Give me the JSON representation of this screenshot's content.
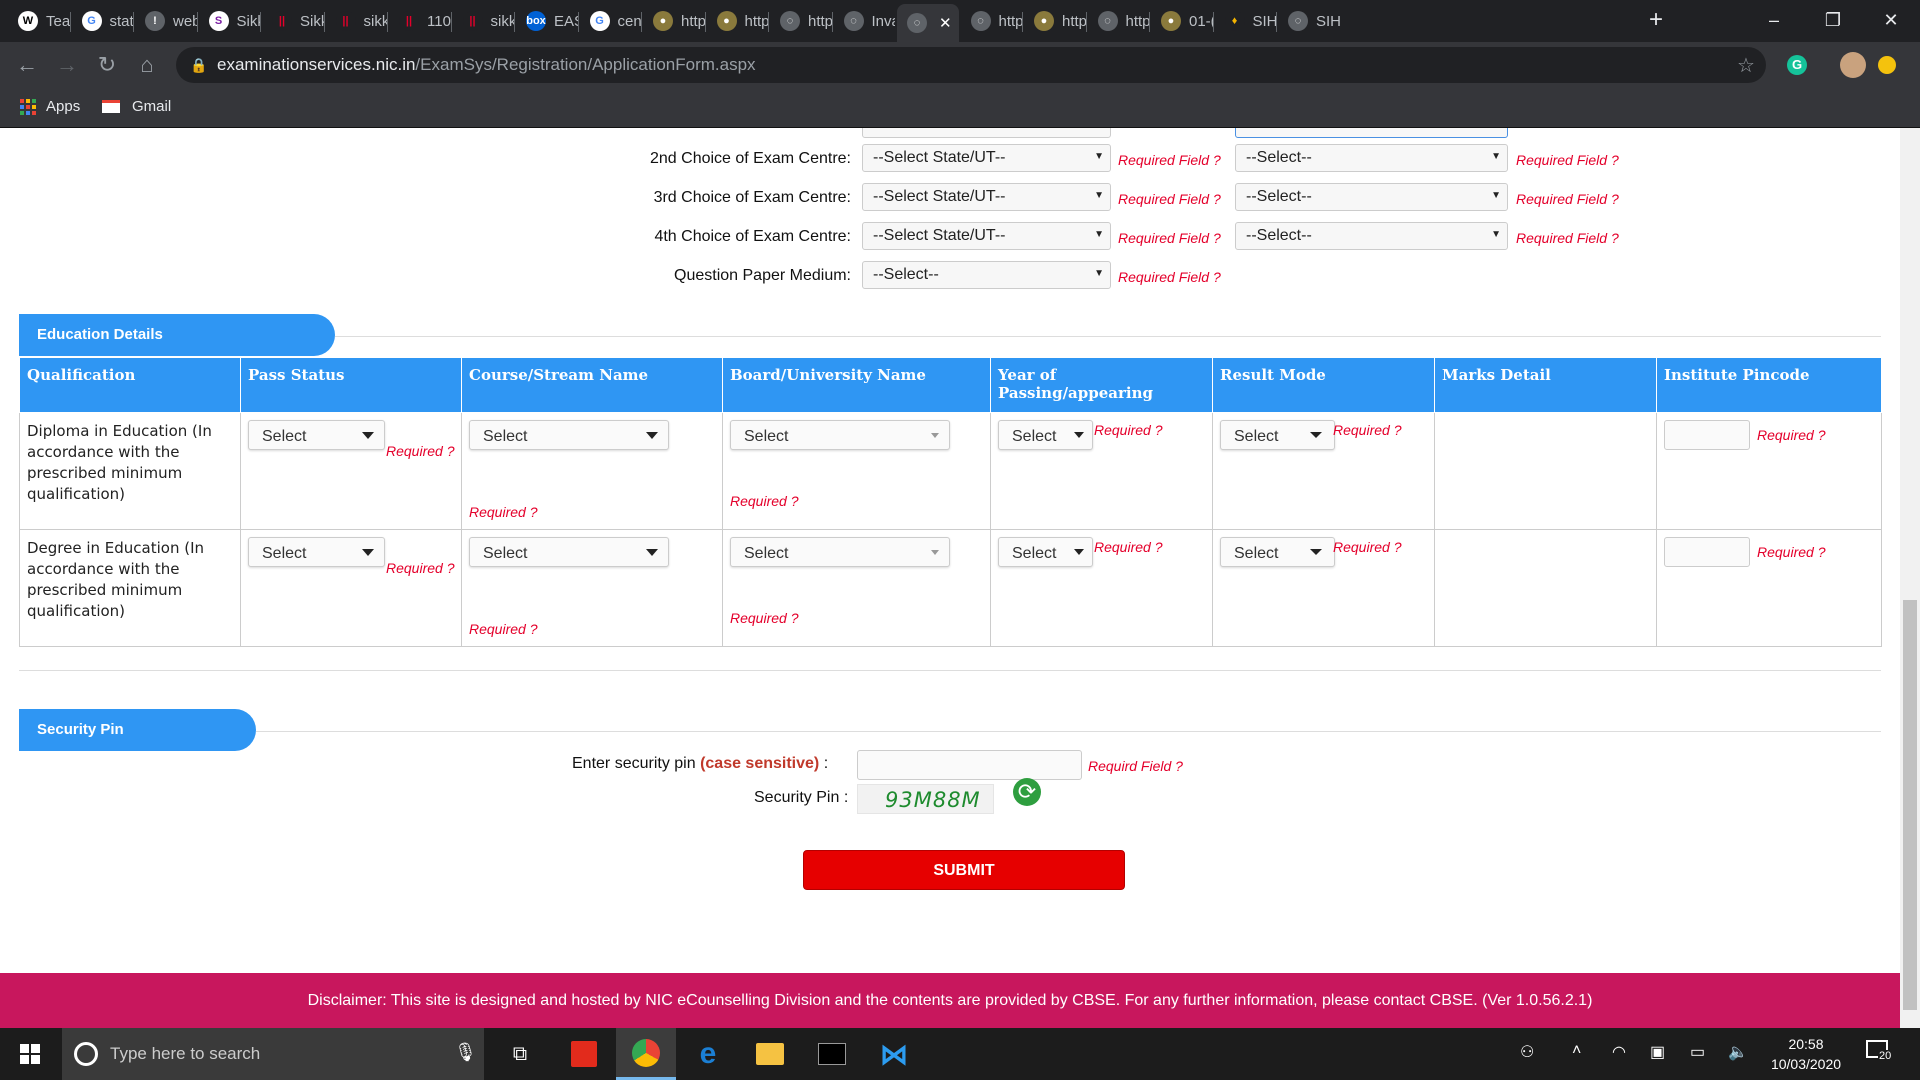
{
  "browser": {
    "tabs": [
      {
        "label": "Teac",
        "fav": "W",
        "color": "#fff",
        "fg": "#000"
      },
      {
        "label": "state",
        "fav": "G",
        "color": "#fff",
        "fg": "#4285f4"
      },
      {
        "label": "web",
        "fav": "!",
        "color": "#5f6368",
        "fg": "#fff"
      },
      {
        "label": "Sikk",
        "fav": "S",
        "color": "#fff",
        "fg": "#7a1fa2"
      },
      {
        "label": "Sikk",
        "fav": "||",
        "color": "#202124",
        "fg": "#e4002b"
      },
      {
        "label": "sikk",
        "fav": "||",
        "color": "#202124",
        "fg": "#e4002b"
      },
      {
        "label": "110",
        "fav": "||",
        "color": "#202124",
        "fg": "#e4002b"
      },
      {
        "label": "sikk",
        "fav": "||",
        "color": "#202124",
        "fg": "#e4002b"
      },
      {
        "label": "EAS",
        "fav": "box",
        "color": "#0061d5",
        "fg": "#fff"
      },
      {
        "label": "cent",
        "fav": "G",
        "color": "#fff",
        "fg": "#4285f4"
      },
      {
        "label": "http",
        "fav": "●",
        "color": "#8a7a3c",
        "fg": "#fff"
      },
      {
        "label": "http",
        "fav": "●",
        "color": "#8a7a3c",
        "fg": "#fff"
      },
      {
        "label": "http",
        "fav": "◌",
        "color": "#5f6368",
        "fg": "#fff"
      },
      {
        "label": "Inva",
        "fav": "◌",
        "color": "#5f6368",
        "fg": "#fff"
      },
      {
        "label": "",
        "fav": "◌",
        "color": "#5f6368",
        "fg": "#fff"
      },
      {
        "label": "http",
        "fav": "◌",
        "color": "#5f6368",
        "fg": "#fff"
      },
      {
        "label": "http",
        "fav": "●",
        "color": "#8a7a3c",
        "fg": "#fff"
      },
      {
        "label": "http",
        "fav": "◌",
        "color": "#5f6368",
        "fg": "#fff"
      },
      {
        "label": "01-(",
        "fav": "●",
        "color": "#8a7a3c",
        "fg": "#fff"
      },
      {
        "label": "SIH",
        "fav": "♦",
        "color": "#202124",
        "fg": "#f4b400"
      },
      {
        "label": "SIH",
        "fav": "◌",
        "color": "#5f6368",
        "fg": "#fff"
      }
    ],
    "url_host": "examinationservices.nic.in",
    "url_path": "/ExamSys/Registration/ApplicationForm.aspx",
    "bookmarks": [
      {
        "label": "Apps"
      },
      {
        "label": "Gmail"
      }
    ]
  },
  "exam_centre": {
    "rows": [
      {
        "label": "2nd Choice of Exam Centre:",
        "state": "--Select State/UT--",
        "state_req": "Required Field ?",
        "city": "--Select--",
        "city_req": "Required Field ?"
      },
      {
        "label": "3rd Choice of Exam Centre:",
        "state": "--Select State/UT--",
        "state_req": "Required Field ?",
        "city": "--Select--",
        "city_req": "Required Field ?"
      },
      {
        "label": "4th Choice of Exam Centre:",
        "state": "--Select State/UT--",
        "state_req": "Required Field ?",
        "city": "--Select--",
        "city_req": "Required Field ?"
      }
    ],
    "medium_label": "Question Paper Medium:",
    "medium_value": "--Select--",
    "medium_req": "Required Field ?"
  },
  "education": {
    "heading": "Education Details",
    "columns": [
      "Qualification",
      "Pass Status",
      "Course/Stream Name",
      "Board/University Name",
      "Year of Passing/appearing",
      "Result Mode",
      "Marks Detail",
      "Institute Pincode"
    ],
    "rows": [
      {
        "qualification": "Diploma in Education (In accordance with the prescribed minimum qualification)",
        "pass_status": "Select",
        "course": "Select",
        "board": "Select",
        "year": "Select",
        "result": "Select",
        "req": "Required ?"
      },
      {
        "qualification": "Degree in Education (In accordance with the prescribed minimum qualification)",
        "pass_status": "Select",
        "course": "Select",
        "board": "Select",
        "year": "Select",
        "result": "Select",
        "req": "Required ?"
      }
    ]
  },
  "security": {
    "heading": "Security Pin",
    "enter_label": "Enter security pin",
    "case_note": "(case sensitive)",
    "colon": ":",
    "enter_req": "Requird Field ?",
    "pin_label": "Security Pin :",
    "captcha": "93M88M"
  },
  "submit_label": "SUBMIT",
  "disclaimer": "Disclaimer: This site is designed and hosted by NIC eCounselling Division and the contents are provided by CBSE. For any further information, please contact CBSE. (Ver 1.0.56.2.1)",
  "taskbar": {
    "search_placeholder": "Type here to search",
    "time": "20:58",
    "date": "10/03/2020",
    "notification_count": "20"
  }
}
